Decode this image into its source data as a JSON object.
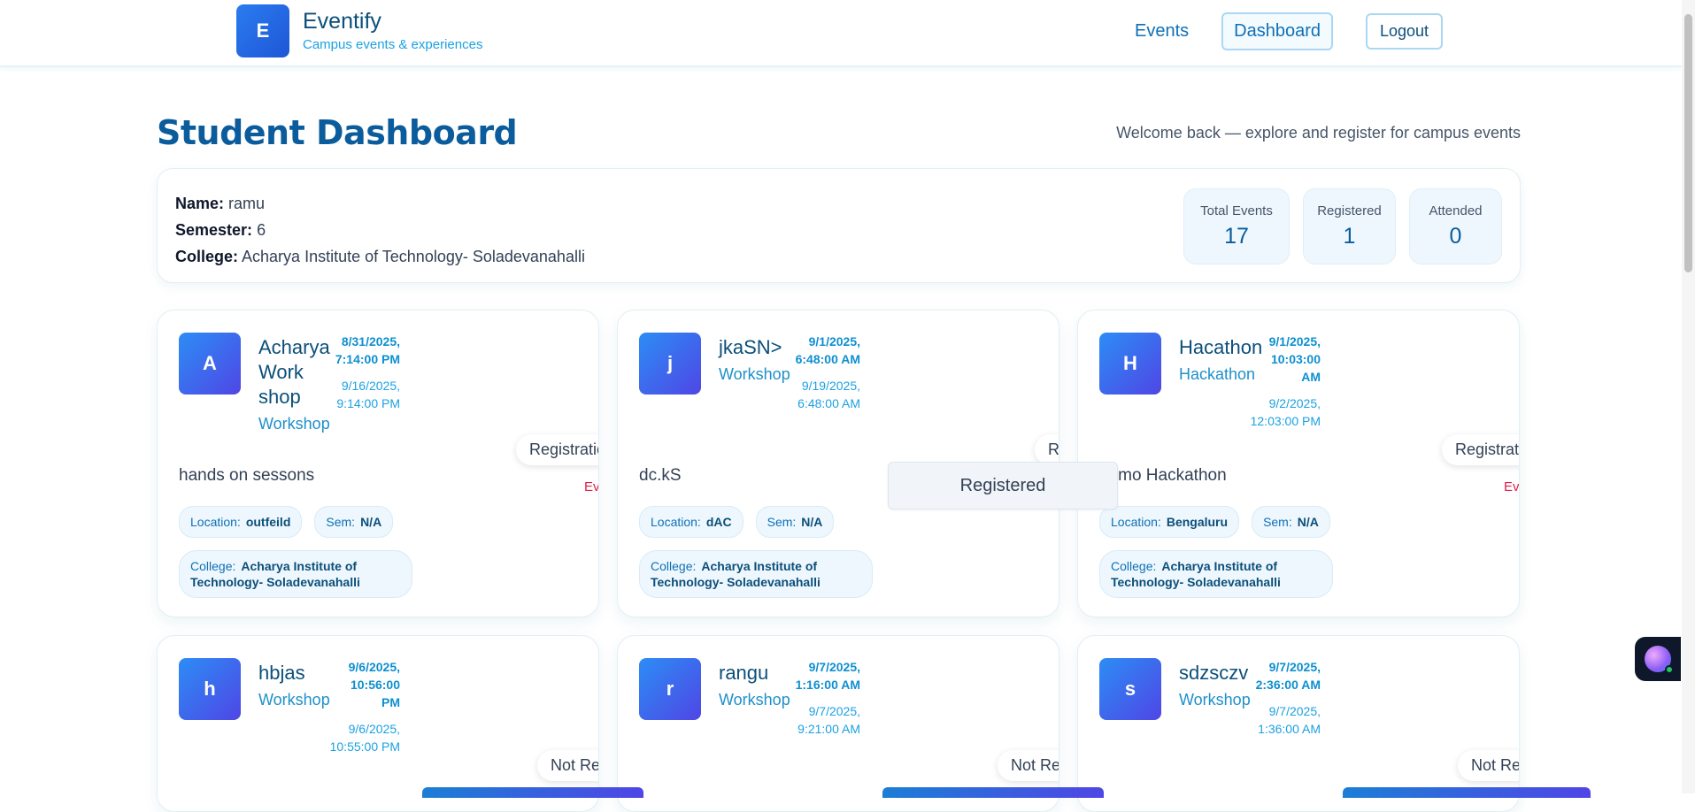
{
  "header": {
    "logo_letter": "E",
    "brand_name": "Eventify",
    "brand_tagline": "Campus events & experiences",
    "nav": {
      "events": "Events",
      "dashboard": "Dashboard",
      "logout": "Logout"
    }
  },
  "page": {
    "title": "Student Dashboard",
    "welcome": "Welcome back — explore and register for campus events"
  },
  "profile": {
    "name_label": "Name:",
    "name": "ramu",
    "semester_label": "Semester:",
    "semester": "6",
    "college_label": "College:",
    "college": "Acharya Institute of Technology- Soladevanahalli",
    "stats": {
      "total_label": "Total Events",
      "total": "17",
      "registered_label": "Registered",
      "registered": "1",
      "attended_label": "Attended",
      "attended": "0"
    }
  },
  "events": [
    {
      "letter": "A",
      "title": "Acharya Work shop",
      "category": "Workshop",
      "start": "8/31/2025, 7:14:00 PM",
      "end": "9/16/2025, 9:14:00 PM",
      "description": "hands on sessons",
      "location_label": "Location:",
      "location": "outfeild",
      "sem_label": "Sem:",
      "sem": "N/A",
      "college_label": "College:",
      "college": "Acharya Institute of Technology- Soladevanahalli",
      "status": "Registration",
      "completed": "Event"
    },
    {
      "letter": "j",
      "title": "jkaSN>",
      "category": "Workshop",
      "start": "9/1/2025, 6:48:00 AM",
      "end": "9/19/2025, 6:48:00 AM",
      "description": "dc.kS",
      "location_label": "Location:",
      "location": "dAC",
      "sem_label": "Sem:",
      "sem": "N/A",
      "college_label": "College:",
      "college": "Acharya Institute of Technology- Soladevanahalli",
      "status": "Regi",
      "registered_button": "Registered"
    },
    {
      "letter": "H",
      "title": "Hacathon",
      "category": "Hackathon",
      "start": "9/1/2025, 10:03:00 AM",
      "end": "9/2/2025, 12:03:00 PM",
      "description": "demo Hackathon",
      "location_label": "Location:",
      "location": "Bengaluru",
      "sem_label": "Sem:",
      "sem": "N/A",
      "college_label": "College:",
      "college": "Acharya Institute of Technology- Soladevanahalli",
      "status": "Registration Closed",
      "completed": "Event Completed"
    },
    {
      "letter": "h",
      "title": "hbjas",
      "category": "Workshop",
      "start": "9/6/2025, 10:56:00 PM",
      "end": "9/6/2025, 10:55:00 PM",
      "status": "Not Regis"
    },
    {
      "letter": "r",
      "title": "rangu",
      "category": "Workshop",
      "start": "9/7/2025, 1:16:00 AM",
      "end": "9/7/2025, 9:21:00 AM",
      "status": "Not Regis"
    },
    {
      "letter": "s",
      "title": "sdzsczv",
      "category": "Workshop",
      "start": "9/7/2025, 2:36:00 AM",
      "end": "9/7/2025, 1:36:00 AM",
      "status": "Not Registered"
    }
  ]
}
